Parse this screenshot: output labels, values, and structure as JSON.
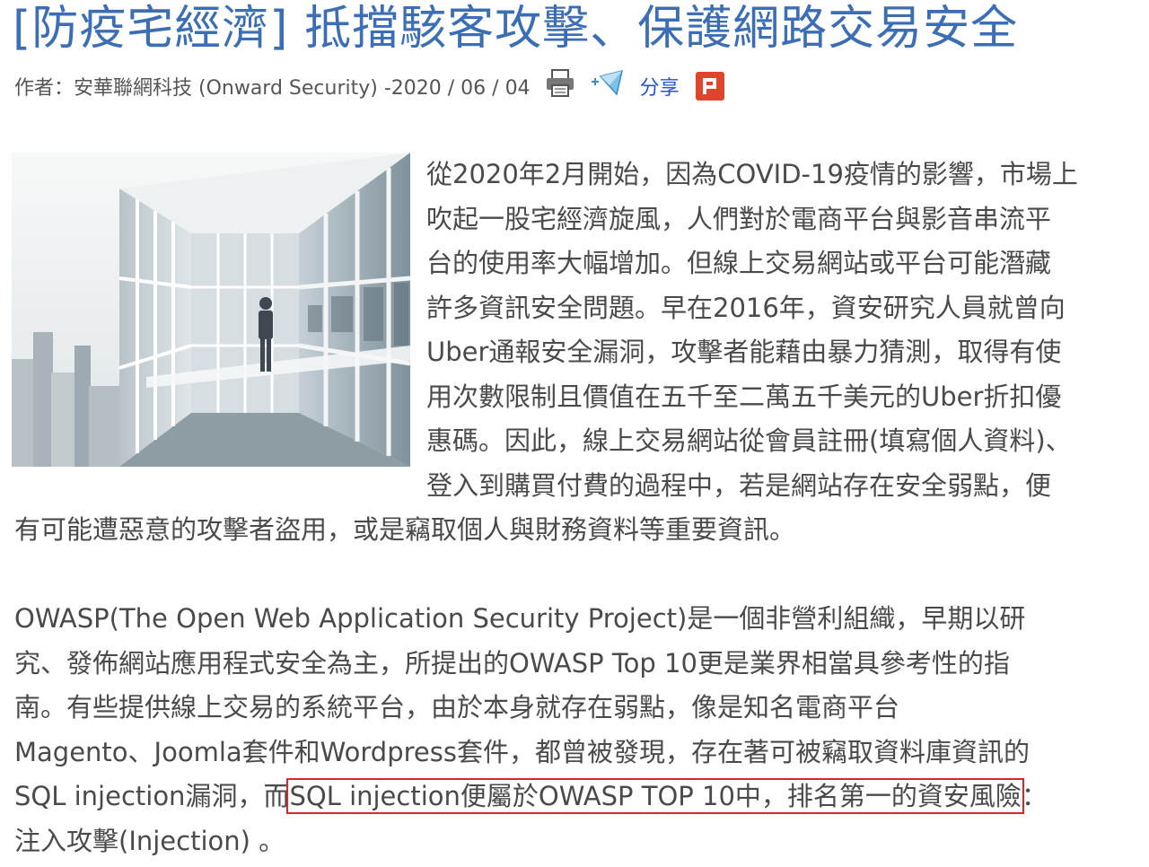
{
  "article": {
    "title": "[防疫宅經濟] 抵擋駭客攻擊、保護網路交易安全",
    "byline": "作者：安華聯網科技 (Onward Security) -2020 / 06 / 04",
    "share_label": "分享",
    "icons": [
      "printer-icon",
      "send-email-icon",
      "plurk-share-icon"
    ],
    "paragraph1_lines": [
      "從2020年2月開始，因為COVID-19疫情的影響，市場上",
      "吹起一股宅經濟旋風，人們對於電商平台與影音串流平",
      "台的使用率大幅增加。但線上交易網站或平台可能潛藏",
      "許多資訊安全問題。早在2016年，資安研究人員就曾向",
      "Uber通報安全漏洞，攻擊者能藉由暴力猜測，取得有使",
      "用次數限制且價值在五千至二萬五千美元的Uber折扣優",
      "惠碼。因此，線上交易網站從會員註冊(填寫個人資料)、",
      "登入到購買付費的過程中，若是網站存在安全弱點，便"
    ],
    "paragraph1_tail": "有可能遭惡意的攻擊者盜用，或是竊取個人與財務資料等重要資訊。",
    "paragraph2_lines": [
      "OWASP(The Open Web Application Security Project)是一個非營利組織，早期以研",
      "究、發佈網站應用程式安全為主，所提出的OWASP Top 10更是業界相當具參考性的指",
      "南。有些提供線上交易的系統平台，由於本身就存在弱點，像是知名電商平台",
      "Magento、Joomla套件和Wordpress套件，都曾被發現，存在著可被竊取資料庫資訊的"
    ],
    "paragraph2_line5_before": "SQL injection漏洞，而",
    "paragraph2_highlight": "SQL injection便屬於OWASP TOP 10中，排名第一的資安風險",
    "paragraph2_line5_after": "：",
    "paragraph2_line6": "注入攻擊(Injection) 。"
  },
  "colors": {
    "title": "#3b6eb5",
    "body_text": "#4a4a4a",
    "highlight_box": "#d8262e",
    "share_link": "#2255cc",
    "plurk_badge": "#e0452c"
  }
}
